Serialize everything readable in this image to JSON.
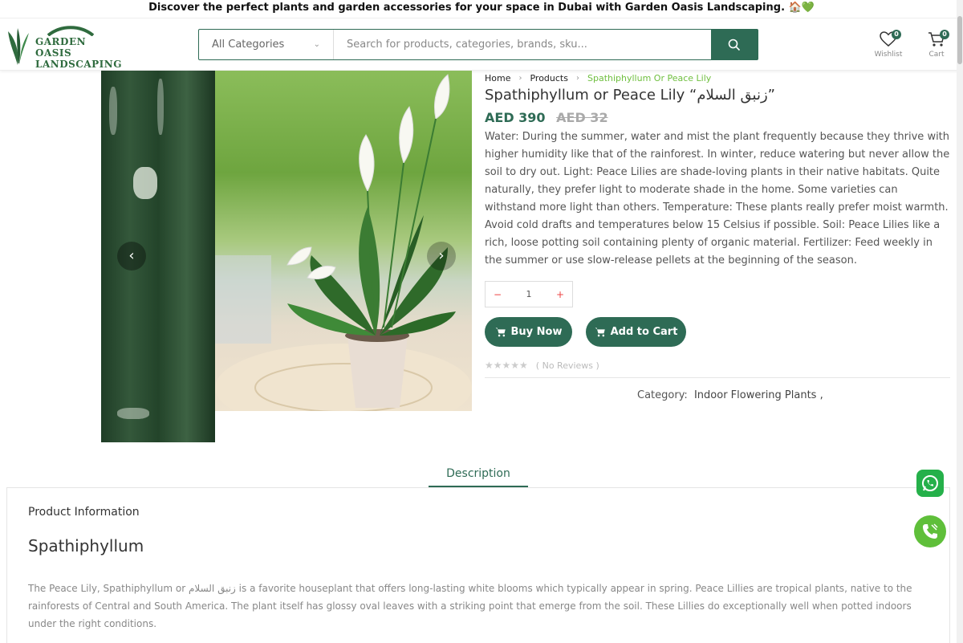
{
  "promo": {
    "text": "Discover the perfect plants and garden accessories for your space in Dubai with Garden Oasis Landscaping. 🏠💚"
  },
  "brand": {
    "line1": "GARDEN OASIS",
    "line2": "LANDSCAPING"
  },
  "search": {
    "category": "All Categories",
    "placeholder": "Search for products, categories, brands, sku..."
  },
  "header_icons": {
    "wishlist": {
      "label": "Wishlist",
      "count": "0"
    },
    "cart": {
      "label": "Cart",
      "count": "0"
    }
  },
  "breadcrumb": {
    "home": "Home",
    "products": "Products",
    "current": "Spathiphyllum Or Peace Lily"
  },
  "product": {
    "title": "Spathiphyllum or Peace Lily “زنبق السلام”",
    "price": "AED 390",
    "old_price": "AED 32",
    "description": "Water: During the summer, water and mist the plant frequently because they thrive with higher humidity like that of the rainforest. In winter, reduce watering but never allow the soil to dry out. Light: Peace Lilies are shade-loving plants in their native habitats. Quite naturally, they prefer light to moderate shade in the home. Some varieties can withstand more light than others. Temperature: These plants really prefer moist warmth. Avoid cold drafts and temperatures below 15 Celsius if possible. Soil: Peace Lilies like a rich, loose potting soil containing plenty of organic material. Fertilizer: Feed weekly in the summer or use slow-release pellets at the beginning of the season.",
    "quantity": "1",
    "qty_minus": "−",
    "qty_plus": "+",
    "buy_now": "Buy Now",
    "add_to_cart": "Add to Cart",
    "stars": "★★★★★",
    "reviews": "( No Reviews )",
    "category_label": "Category:",
    "category_value": "Indoor Flowering Plants ,"
  },
  "tabs": {
    "description": "Description"
  },
  "panel": {
    "label": "Product Information",
    "heading": "Spathiphyllum",
    "text": "The Peace Lily, Spathiphyllum or زنبق السلام is a favorite houseplant that offers long-lasting white blooms which typically appear in spring. Peace Lillies are tropical plants, native to the rainforests of Central and South America. The plant itself has glossy oval leaves with a striking point that emerge from the soil. These Lillies do exceptionally well when potted indoors under the right conditions."
  },
  "colors": {
    "primary": "#2e6b55",
    "accent": "#6fbf3f",
    "whatsapp": "#25b04a"
  }
}
